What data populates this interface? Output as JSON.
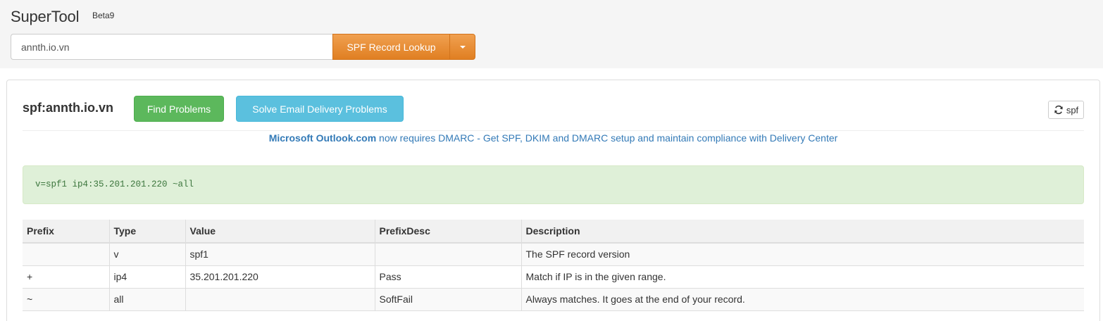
{
  "header": {
    "brand": "SuperTool",
    "badge": "Beta9",
    "search_value": "annth.io.vn",
    "lookup_label": "SPF Record Lookup"
  },
  "panel": {
    "title": "spf:annth.io.vn",
    "find_label": "Find Problems",
    "solve_label": "Solve Email Delivery Problems",
    "refresh_label": "spf",
    "notice_bold": "Microsoft Outlook.com",
    "notice_rest": " now requires DMARC - Get SPF, DKIM and DMARC setup and maintain compliance with Delivery Center",
    "record": "v=spf1 ip4:35.201.201.220 ~all"
  },
  "table": {
    "headers": [
      "Prefix",
      "Type",
      "Value",
      "PrefixDesc",
      "Description"
    ],
    "rows": [
      [
        "",
        "v",
        "spf1",
        "",
        "The SPF record version"
      ],
      [
        "+",
        "ip4",
        "35.201.201.220",
        "Pass",
        "Match if IP is in the given range."
      ],
      [
        "~",
        "all",
        "",
        "SoftFail",
        "Always matches. It goes at the end of your record."
      ]
    ]
  },
  "colors": {
    "lookup_button": "#e98c33",
    "find_button": "#5cb85c",
    "solve_button": "#5bc0de",
    "notice_link": "#337ab7",
    "record_bg": "#dff0d8",
    "record_text": "#3c763d"
  },
  "icons": {
    "caret": "caret-down-icon",
    "refresh": "refresh-icon"
  }
}
